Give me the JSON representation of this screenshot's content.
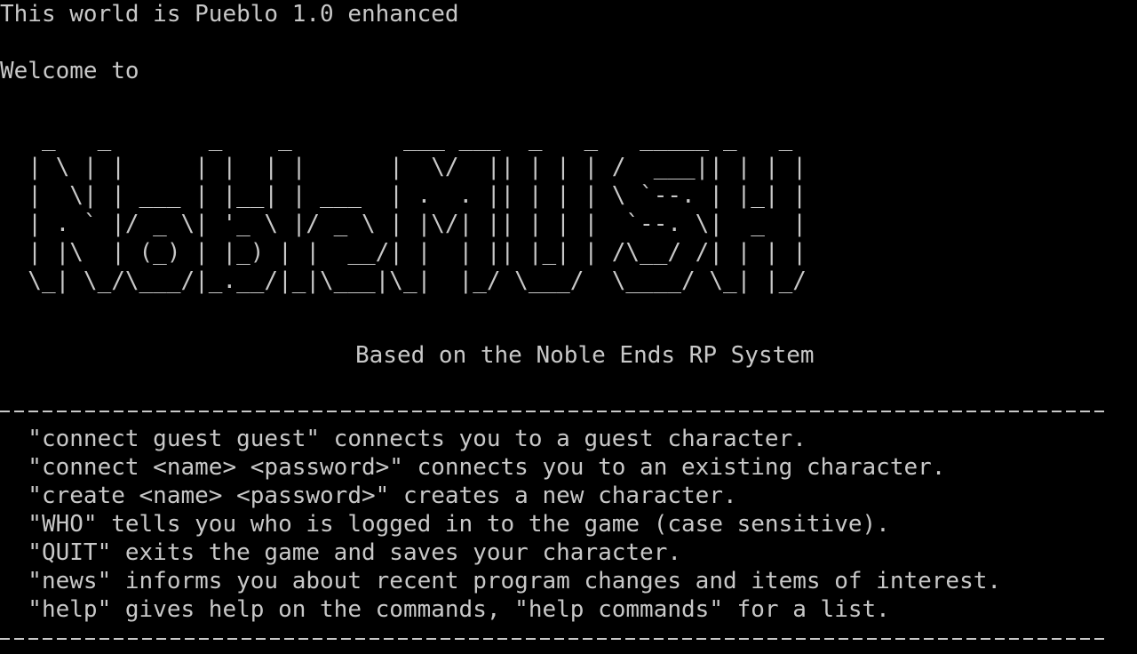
{
  "terminal": {
    "world_line": "This world is Pueblo 1.0 enhanced",
    "welcome_line": "Welcome to",
    "logo_art": "   _   _       _    _        ___ ___  _   _   _____ _   _\n  | \\ | |     | |  | |      |  \\/  || | | | /  ___|| | | |\n  |  \\| | ___ | |__| | ___  | .  . || | | | \\ `--. | |_| |\n  | . ` |/ _ \\| '_ \\ |/ _ \\ | |\\/| || | | |  `--. \\|  _  |\n  | |\\  | (_) | |_) | |  __/| |  | || |_| | /\\__/ /| | | |\n  \\_| \\_/\\___/|_.__/|_|\\___|\\_|  |_/ \\___/  \\____/ \\_| |_/",
    "tagline": "Based on the Noble Ends RP System",
    "commands": [
      "  \"connect guest guest\" connects you to a guest character.",
      "  \"connect <name> <password>\" connects you to an existing character.",
      "  \"create <name> <password>\" creates a new character.",
      "  \"WHO\" tells you who is logged in to the game (case sensitive).",
      "  \"QUIT\" exits the game and saves your character.",
      "  \"news\" informs you about recent program changes and items of interest.",
      "  \"help\" gives help on the commands, \"help commands\" for a list."
    ]
  }
}
